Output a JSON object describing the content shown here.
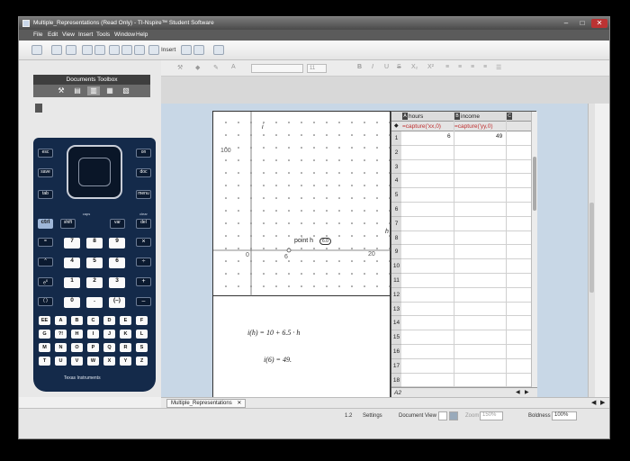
{
  "window": {
    "title": "Multiple_Representations (Read Only) - TI-Nspire™ Student Software",
    "controls": [
      "–",
      "□",
      "✕"
    ]
  },
  "menu": [
    "File",
    "Edit",
    "View",
    "Insert",
    "Tools",
    "Window",
    "Help"
  ],
  "toolbar": {
    "insert_label": "Insert"
  },
  "ruler": {
    "font_size": "11"
  },
  "toolbox": {
    "title": "Documents Toolbox"
  },
  "calculator": {
    "brand": "Texas Instruments",
    "labels": {
      "esc": "esc",
      "save": "save",
      "tab": "tab",
      "on": "on",
      "doc": "doc",
      "menu": "menu",
      "ctrl": "ctrl",
      "shift": "shift",
      "del": "del",
      "clear": "clear",
      "var": "var",
      "caps": "caps",
      "enter": "enter",
      "trig": "trig",
      "x": "x",
      "undo": "undo",
      "redo": "redo",
      "add_page": "+ page"
    },
    "numkeys": [
      "7",
      "8",
      "9",
      "4",
      "5",
      "6",
      "1",
      "2",
      "3",
      "0",
      ".",
      "(–)"
    ],
    "ops": [
      "×",
      "÷",
      "+",
      "–"
    ],
    "letters": [
      "EE",
      "A",
      "B",
      "C",
      "D",
      "E",
      "F",
      "G",
      "?!",
      "H",
      "I",
      "J",
      "K",
      "L",
      "M",
      "N",
      "O",
      "P",
      "Q",
      "R",
      "S",
      "T",
      "U",
      "V",
      "W",
      "X",
      "Y",
      "Z"
    ]
  },
  "graph": {
    "y_axis_label": "i",
    "x_axis_label": "h",
    "y_tick": "100",
    "x_ticks": [
      "0",
      "6",
      "20"
    ],
    "point_label": "point h",
    "point_badge": "6.0"
  },
  "notes": {
    "function": "i(h) = 10 + 6.5 · h",
    "evaluation": "i(6) = 49."
  },
  "spreadsheet": {
    "columns": [
      {
        "letter": "A",
        "name": "hours",
        "formula": "=capture('xx,0)",
        "value": "6"
      },
      {
        "letter": "B",
        "name": "income",
        "formula": "=capture('yy,0)",
        "value": "49"
      },
      {
        "letter": "C",
        "name": "",
        "formula": "",
        "value": ""
      }
    ],
    "rows": [
      "1",
      "2",
      "3",
      "4",
      "5",
      "6",
      "7",
      "8",
      "9",
      "10",
      "11",
      "12",
      "13",
      "14",
      "15",
      "16",
      "17",
      "18"
    ],
    "cell_ref": "A2"
  },
  "tab": {
    "label": "Multiple_Representations"
  },
  "status": {
    "page": "1.2",
    "settings": "Settings",
    "document_view": "Document View",
    "zoom_label": "Zoom",
    "zoom_value": "150%",
    "boldness_label": "Boldness",
    "boldness_value": "100%"
  }
}
